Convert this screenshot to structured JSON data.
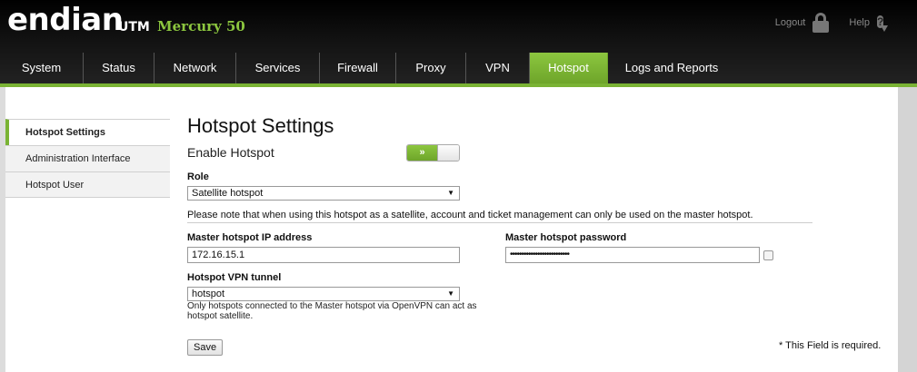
{
  "header": {
    "logo": "endian",
    "product": "UTM",
    "model": "Mercury 50",
    "logout_label": "Logout",
    "help_label": "Help",
    "help_glyph": "?"
  },
  "nav": {
    "items": [
      "System",
      "Status",
      "Network",
      "Services",
      "Firewall",
      "Proxy",
      "VPN",
      "Hotspot",
      "Logs and Reports"
    ],
    "active": "Hotspot",
    "accent_color": "#7ab334"
  },
  "sidebar": {
    "items": [
      "Hotspot Settings",
      "Administration Interface",
      "Hotspot User"
    ],
    "active": "Hotspot Settings"
  },
  "page": {
    "title": "Hotspot Settings",
    "enable_label": "Enable Hotspot",
    "toggle_on_glyph": "»",
    "toggle_state": "on",
    "role_label": "Role",
    "role_value": "Satellite hotspot",
    "note": "Please note that when using this hotspot as a satellite, account and ticket management can only be used on the master hotspot.",
    "master_ip_label": "Master hotspot IP address",
    "master_ip_value": "172.16.15.1",
    "master_pw_label": "Master hotspot password",
    "master_pw_value": "••••••••••••••••••••••••••",
    "vpn_label": "Hotspot VPN tunnel",
    "vpn_value": "hotspot",
    "vpn_hint": "Only hotspots connected to the Master hotspot via OpenVPN can act as hotspot satellite.",
    "save_label": "Save",
    "required_note": "* This Field is required."
  }
}
